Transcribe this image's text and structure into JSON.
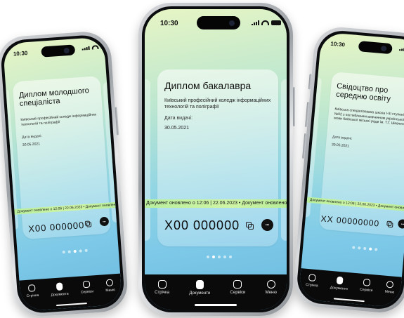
{
  "phones": [
    {
      "time": "10:30",
      "doc_title": "Диплом молодшого спеціаліста",
      "issuer": "Київський професійний коледж інформаційних технологій та поліграфії",
      "date_label": "Дата видачі:",
      "date_value": "30.05.2021",
      "ticker": "Документ оновлено о 12:06 | 22.06.2023 • Документ оновлено",
      "doc_number": "Х00 000000",
      "more_symbol": "•••",
      "tabs": [
        "Стрічка",
        "Документи",
        "Сервіси",
        "Меню"
      ]
    },
    {
      "time": "10:30",
      "doc_title": "Диплом бакалавра",
      "issuer": "Київський професійний коледж інформаційних технологій та поліграфії",
      "date_label": "Дата видачі:",
      "date_value": "30.05.2021",
      "ticker": "Документ оновлено о 12:06 | 22.06.2023 • Документ оновлено",
      "doc_number": "Х00 000000",
      "more_symbol": "•••",
      "tabs": [
        "Стрічка",
        "Документи",
        "Сервіси",
        "Меню"
      ]
    },
    {
      "time": "10:30",
      "doc_title": "Свідоцтво про середню освіту",
      "issuer": "Київська спеціалізована школа І-ІІІ ступенів №92 з поглибленим вивченням української мови Київської міської ради ім. Т.Г. Шевченка",
      "date_label": "Дата видачі:",
      "date_value": "30.05.2021",
      "ticker": "Документ оновлено о 12:06 | 22.06.2023 • Документ оновлено",
      "doc_number": "ХХ 00000000",
      "more_symbol": "•••",
      "tabs": [
        "Стрічка",
        "Документи",
        "Сервіси",
        "Меню"
      ]
    }
  ],
  "colors": {
    "ticker": "#c6f2a0",
    "tabbar": "#0a0a0a",
    "screen_top": "#e7f5c4",
    "screen_bottom": "#69b9de"
  },
  "icons": [
    "feed-icon",
    "documents-icon",
    "services-icon",
    "menu-icon",
    "copy-icon",
    "more-icon"
  ]
}
